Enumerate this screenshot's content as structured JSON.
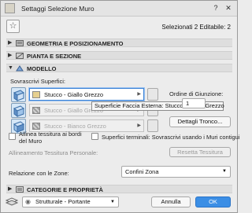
{
  "window": {
    "title": "Settaggi Selezione Muro"
  },
  "header": {
    "selection_info": "Selezionati 2 Editabile: 2"
  },
  "sections": {
    "geometry": "GEOMETRIA E POSIZIONAMENTO",
    "plan": "PIANTA E SEZIONE",
    "model": "MODELLO",
    "categories": "CATEGORIE E PROPRIETÀ"
  },
  "model": {
    "override_label": "Sovrascrivi Superfici:",
    "surfaces": [
      {
        "text": "Stucco - Giallo Grezzo",
        "color": "#e6cf8f",
        "state": "active"
      },
      {
        "text": "Stucco - Giallo Grezzo",
        "color": "#9a9a9a",
        "state": "disabled"
      },
      {
        "text": "Stucco - Bianco Grezzo",
        "color": "#9a9a9a",
        "state": "disabled"
      }
    ],
    "tooltip": "Superficie Faccia Esterna: Stucco - Giallo Grezzo",
    "join_order_label": "Ordine di Giunzione:",
    "join_order_value": "1",
    "detail_button": "Dettagli Tronco...",
    "align_texture_label": "Allinea tessitura ai bordi del Muro",
    "terminal_surfaces_label": "Superfici terminali: Sovrascrivi usando i Muri contigui",
    "custom_alignment_label": "Allineamento Tessitura Personale:",
    "reset_texture_button": "Resetta Tessitura",
    "zones_label": "Relazione con le Zone:",
    "zones_value": "Confini Zona"
  },
  "footer": {
    "layer_value": "Strutturale - Portante",
    "cancel": "Annulla",
    "ok": "OK"
  },
  "colors": {
    "accent": "#3b8ee5",
    "tooltip_bg": "#f7f7f7"
  }
}
